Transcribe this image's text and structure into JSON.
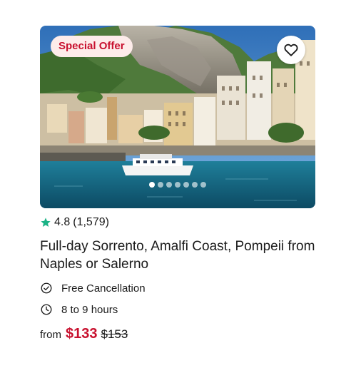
{
  "card": {
    "badge": "Special Offer",
    "image": {
      "slides_total": 7,
      "active_slide": 1
    },
    "rating": {
      "score": "4.8",
      "reviews": "(1,579)",
      "star_color": "#1bb386"
    },
    "title": "Full-day Sorrento, Amalfi Coast, Pompeii from Naples or Salerno",
    "features": [
      {
        "icon": "check-circle-icon",
        "label": "Free Cancellation"
      },
      {
        "icon": "clock-icon",
        "label": "8 to 9 hours"
      }
    ],
    "price": {
      "from_label": "from",
      "current": "$133",
      "original": "$153",
      "accent_color": "#c8102e"
    }
  }
}
